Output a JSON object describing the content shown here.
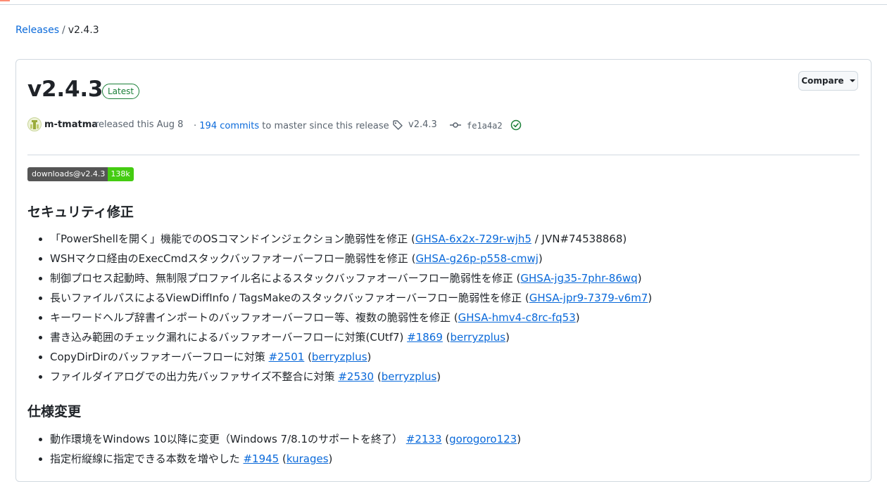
{
  "breadcrumb": {
    "root": "Releases",
    "separator": "/",
    "current": "v2.4.3"
  },
  "release": {
    "title": "v2.4.3",
    "latest_label": "Latest",
    "compare_label": "Compare",
    "author": "m-tmatma",
    "released_text": "released this Aug 8",
    "commits_prefix": "·",
    "commits_link": "194 commits",
    "commits_suffix": "to master since this release",
    "tag": "v2.4.3",
    "sha": "fe1a4a2"
  },
  "badge": {
    "label": "downloads@v2.4.3",
    "value": "138k",
    "label_color": "#555555",
    "value_color": "#44cc11"
  },
  "sections": [
    {
      "heading": "セキュリティ修正",
      "items": [
        {
          "text": "「PowerShellを開く」機能でのOSコマンドインジェクション脆弱性を修正 (",
          "link": "GHSA-6x2x-729r-wjh5",
          "after": " / JVN#74538868)"
        },
        {
          "text": "WSHマクロ経由のExecCmdスタックバッファオーバーフロー脆弱性を修正 (",
          "link": "GHSA-g26p-p558-cmwj",
          "after": ")"
        },
        {
          "text": "制御プロセス起動時、無制限プロファイル名によるスタックバッファオーバーフロー脆弱性を修正 (",
          "link": "GHSA-jg35-7phr-86wq",
          "after": ")"
        },
        {
          "text": "長いファイルパスによるViewDiffInfo / TagsMakeのスタックバッファオーバーフロー脆弱性を修正 (",
          "link": "GHSA-jpr9-7379-v6m7",
          "after": ")"
        },
        {
          "text": "キーワードヘルプ辞書インポートのバッファオーバーフロー等、複数の脆弱性を修正 (",
          "link": "GHSA-hmv4-c8rc-fq53",
          "after": ")"
        },
        {
          "text": "書き込み範囲のチェック漏れによるバッファオーバーフローに対策(CUtf7) ",
          "link": "#1869",
          "mid": " (",
          "link2": "berryzplus",
          "after": ")"
        },
        {
          "text": "CopyDirDirのバッファオーバーフローに対策 ",
          "link": "#2501",
          "mid": " (",
          "link2": "berryzplus",
          "after": ")"
        },
        {
          "text": "ファイルダイアログでの出力先バッファサイズ不整合に対策 ",
          "link": "#2530",
          "mid": " (",
          "link2": "berryzplus",
          "after": ")"
        }
      ]
    },
    {
      "heading": "仕様変更",
      "items": [
        {
          "text": "動作環境をWindows 10以降に変更（Windows 7/8.1のサポートを終了） ",
          "link": "#2133",
          "mid": " (",
          "link2": "gorogoro123",
          "after": ")"
        },
        {
          "text": "指定桁縦線に指定できる本数を増やした ",
          "link": "#1945",
          "mid": " (",
          "link2": "kurages",
          "after": ")"
        }
      ]
    }
  ],
  "colors": {
    "link": "#0969da",
    "latest": "#1a7f37",
    "border": "#d1d9e0"
  },
  "icons": {
    "tag": "tag-icon",
    "commit": "git-commit-icon",
    "verified": "check-circle-icon",
    "caret": "triangle-down-icon"
  }
}
